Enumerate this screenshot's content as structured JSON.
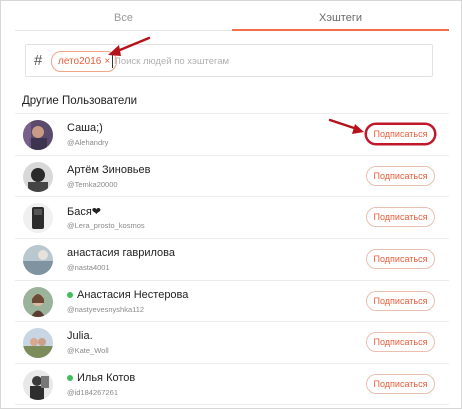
{
  "tabs": [
    {
      "label": "Все",
      "active": false
    },
    {
      "label": "Хэштеги",
      "active": true
    }
  ],
  "search": {
    "hash_symbol": "#",
    "chip_label": "лето2016",
    "chip_remove": "×",
    "placeholder": "Поиск людей по хэштегам"
  },
  "section_title": "Другие Пользователи",
  "colors": {
    "accent": "#f26f4d",
    "online": "#3fbf5a",
    "highlight": "#c0182a"
  },
  "users": [
    {
      "name": "Саша;)",
      "handle": "@Alehandry",
      "online": false,
      "button": "Подписаться"
    },
    {
      "name": "Артём Зиновьев",
      "handle": "@Temka20000",
      "online": false,
      "button": "Подписаться"
    },
    {
      "name": "Бася❤",
      "handle": "@Lera_prosto_kosmos",
      "online": false,
      "button": "Подписаться"
    },
    {
      "name": "анастасия гаврилова",
      "handle": "@nasta4001",
      "online": false,
      "button": "Подписаться"
    },
    {
      "name": "Анастасия Нестерова",
      "handle": "@nastyevesnyshka112",
      "online": true,
      "button": "Подписаться"
    },
    {
      "name": "Julia.",
      "handle": "@Kate_Woll",
      "online": false,
      "button": "Подписаться"
    },
    {
      "name": "Илья Котов",
      "handle": "@id184267261",
      "online": true,
      "button": "Подписаться"
    }
  ]
}
